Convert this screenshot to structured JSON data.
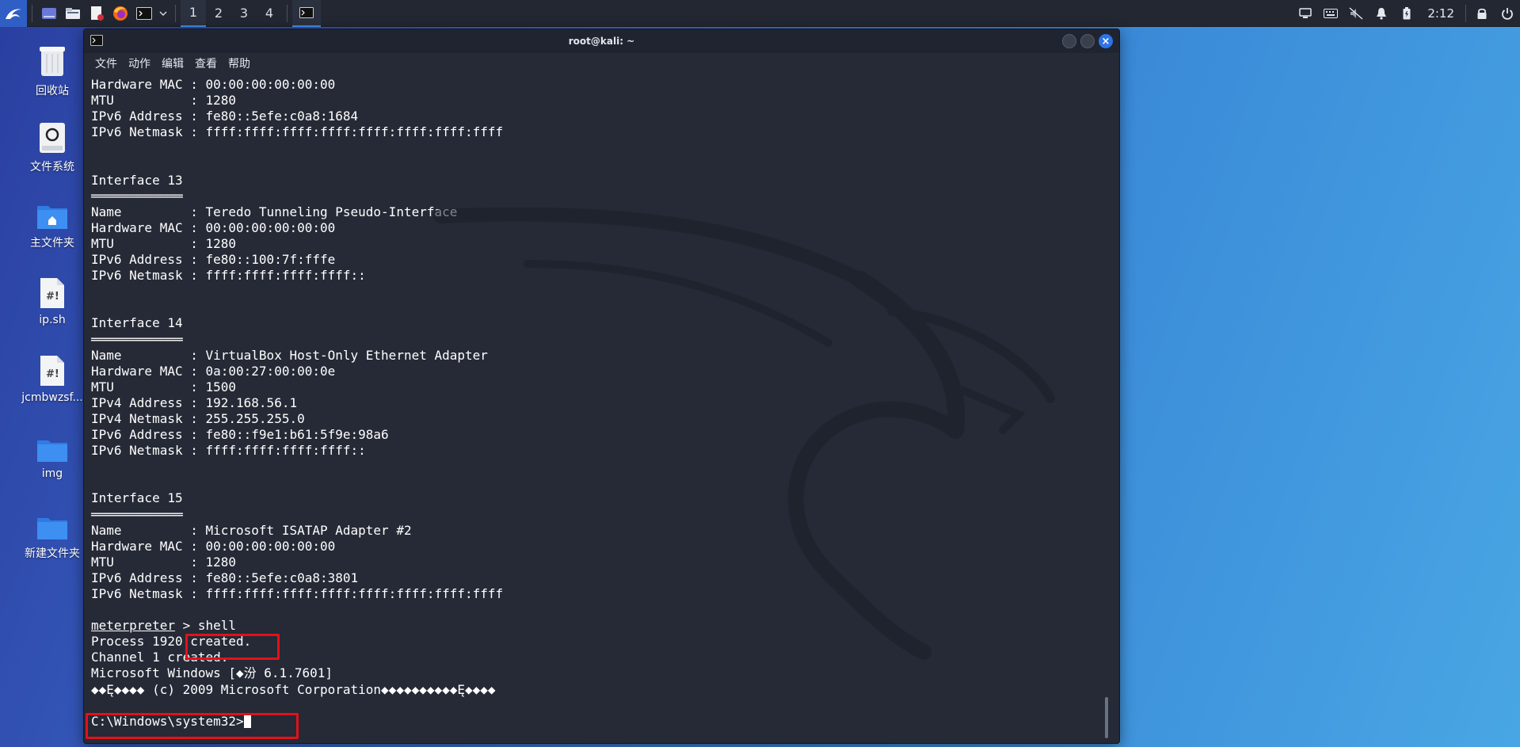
{
  "taskbar": {
    "workspaces": [
      "1",
      "2",
      "3",
      "4"
    ],
    "clock": "2:12",
    "icons": [
      "kali-menu-icon",
      "show-desktop-icon",
      "file-manager-icon",
      "text-editor-icon",
      "firefox-icon",
      "terminal-icon",
      "chevron-down-icon",
      "terminal-task-icon",
      "display-icon",
      "keyboard-icon",
      "volume-muted-icon",
      "notification-bell-icon",
      "battery-icon",
      "lock-icon",
      "power-icon"
    ]
  },
  "desktop": {
    "icons": [
      {
        "label": "回收站",
        "icon": "trash-icon"
      },
      {
        "label": "文件系统",
        "icon": "drive-icon"
      },
      {
        "label": "主文件夹",
        "icon": "home-folder-icon"
      },
      {
        "label": "ip.sh",
        "icon": "script-file-icon"
      },
      {
        "label": "jcmbwzsf...",
        "icon": "script-file-icon"
      },
      {
        "label": "img",
        "icon": "folder-icon"
      },
      {
        "label": "新建文件夹",
        "icon": "folder-icon"
      }
    ]
  },
  "terminal": {
    "title": "root@kali: ~",
    "menu": [
      "文件",
      "动作",
      "编辑",
      "查看",
      "帮助"
    ],
    "lines": [
      "Hardware MAC : 00:00:00:00:00:00",
      "MTU          : 1280",
      "IPv6 Address : fe80::5efe:c0a8:1684",
      "IPv6 Netmask : ffff:ffff:ffff:ffff:ffff:ffff:ffff:ffff",
      "",
      "",
      "Interface 13",
      "════════════",
      "Name         : Teredo Tunneling Pseudo-Interface",
      "Hardware MAC : 00:00:00:00:00:00",
      "MTU          : 1280",
      "IPv6 Address : fe80::100:7f:fffe",
      "IPv6 Netmask : ffff:ffff:ffff:ffff::",
      "",
      "",
      "Interface 14",
      "════════════",
      "Name         : VirtualBox Host-Only Ethernet Adapter",
      "Hardware MAC : 0a:00:27:00:00:0e",
      "MTU          : 1500",
      "IPv4 Address : 192.168.56.1",
      "IPv4 Netmask : 255.255.255.0",
      "IPv6 Address : fe80::f9e1:b61:5f9e:98a6",
      "IPv6 Netmask : ffff:ffff:ffff:ffff::",
      "",
      "",
      "Interface 15",
      "════════════",
      "Name         : Microsoft ISATAP Adapter #2",
      "Hardware MAC : 00:00:00:00:00:00",
      "MTU          : 1280",
      "IPv6 Address : fe80::5efe:c0a8:3801",
      "IPv6 Netmask : ffff:ffff:ffff:ffff:ffff:ffff:ffff:ffff",
      ""
    ],
    "prompt_word": "meterpreter",
    "prompt_cmd": " > shell",
    "output": [
      "Process 1920 created.",
      "Channel 1 created.",
      "Microsoft Windows [◆汾 6.1.7601]",
      "◆◆Ę◆◆◆◆ (c) 2009 Microsoft Corporation◆◆◆◆◆◆◆◆◆◆Ę◆◆◆◆",
      ""
    ],
    "cmd_prompt": "C:\\Windows\\system32>"
  },
  "colors": {
    "terminal_bg": "#252a36",
    "highlight_box": "#e3111a",
    "accent": "#3f8fe8"
  }
}
